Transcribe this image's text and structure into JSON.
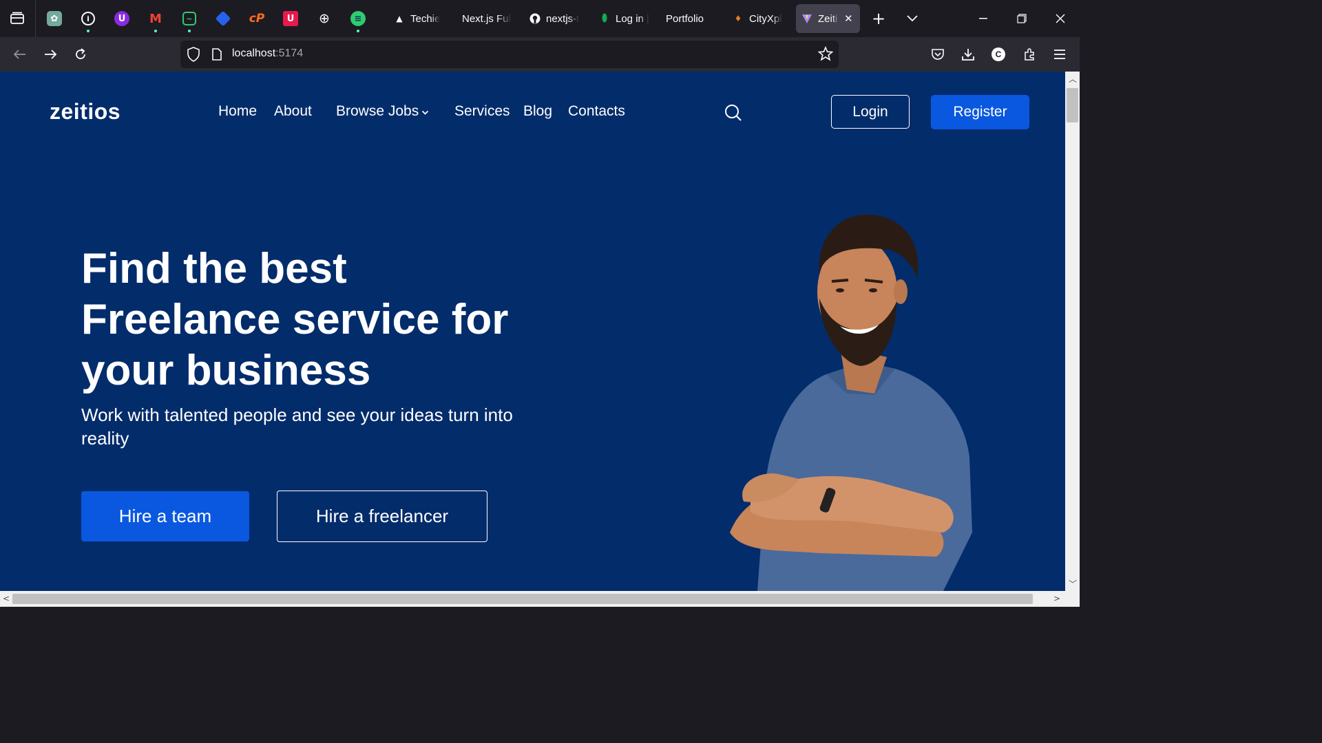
{
  "browser": {
    "pinned_icons": [
      "tab-overview-icon",
      "chatgpt-icon",
      "info-icon",
      "proton-u-icon",
      "gmail-icon",
      "activity-icon",
      "diamond-icon",
      "cp-icon",
      "u-shield-icon",
      "globe-icon",
      "earth-icon"
    ],
    "tabs": [
      {
        "label": "Techie",
        "icon": "triangle-icon"
      },
      {
        "label": "Next.js Full",
        "icon": ""
      },
      {
        "label": "nextjs-t",
        "icon": "github-icon"
      },
      {
        "label": "Log in |",
        "icon": "leaf-icon"
      },
      {
        "label": "Portfolio",
        "icon": ""
      },
      {
        "label": "CityXpl",
        "icon": "pin-icon"
      },
      {
        "label": "Zeiti",
        "icon": "vite-icon",
        "active": true
      }
    ],
    "url_host": "localhost",
    "url_port": ":5174"
  },
  "site": {
    "logo": "zeitios",
    "nav": {
      "home": "Home",
      "about": "About",
      "browse_jobs": "Browse Jobs",
      "services": "Services",
      "blog": "Blog",
      "contacts": "Contacts"
    },
    "login": "Login",
    "register": "Register"
  },
  "hero": {
    "title_line1": "Find the best",
    "title_line2": "Freelance service for",
    "title_line3": "your business",
    "subtitle": "Work with talented people and see your ideas turn into reality",
    "primary_cta": "Hire a team",
    "secondary_cta": "Hire a freelancer"
  },
  "colors": {
    "page_bg": "#032c6b",
    "accent_blue": "#0a58e0",
    "text": "#ffffff"
  }
}
